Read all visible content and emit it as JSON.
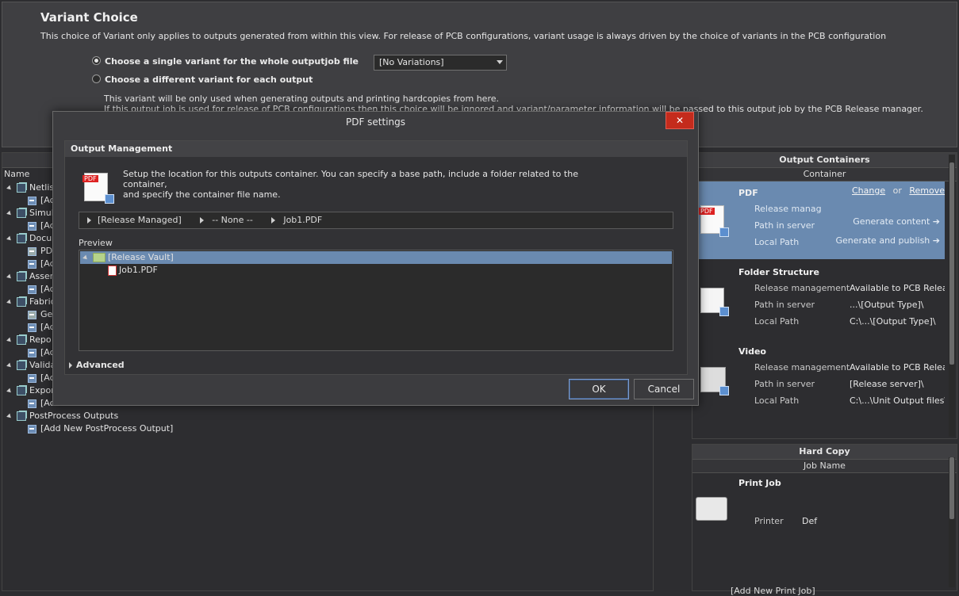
{
  "variant": {
    "title": "Variant Choice",
    "description": "This choice of Variant only applies to outputs generated from within this view. For release of PCB configurations, variant usage is always driven by the choice of variants in the PCB configuration",
    "option_single": "Choose a single variant for the whole outputjob file",
    "option_each": "Choose a different variant for each output",
    "selected_variant": "[No Variations]",
    "note_line1": "This variant will be only used when generating outputs and printing hardcopies from here.",
    "note_line2": "If this output job is used for release of PCB configurations then this choice will be ignored and variant/parameter information will be passed to this output job by the PCB Release manager."
  },
  "tree": {
    "name_header": "Name",
    "rows": [
      {
        "label": "Netlis",
        "kind": "category"
      },
      {
        "label": "[Ac",
        "kind": "add"
      },
      {
        "label": "Simul",
        "kind": "category"
      },
      {
        "label": "[Ac",
        "kind": "add"
      },
      {
        "label": "Docu",
        "kind": "category"
      },
      {
        "label": "PD",
        "kind": "item"
      },
      {
        "label": "[Ac",
        "kind": "add"
      },
      {
        "label": "Assem",
        "kind": "category"
      },
      {
        "label": "[Ac",
        "kind": "add"
      },
      {
        "label": "Fabric",
        "kind": "category"
      },
      {
        "label": "Ge",
        "kind": "item"
      },
      {
        "label": "[Ac",
        "kind": "add"
      },
      {
        "label": "Repo",
        "kind": "category"
      },
      {
        "label": "[Ac",
        "kind": "add"
      },
      {
        "label": "Valida",
        "kind": "category"
      },
      {
        "label": "[Ac",
        "kind": "add"
      },
      {
        "label": "Expor",
        "kind": "category"
      },
      {
        "label": "[Ac",
        "kind": "add"
      },
      {
        "label": "PostProcess Outputs",
        "kind": "category"
      },
      {
        "label": "[Add New PostProcess Output]",
        "kind": "add"
      }
    ]
  },
  "containers": {
    "header": "Output Containers",
    "subheader": "Container",
    "pdf": {
      "title": "PDF",
      "change": "Change",
      "or": "or",
      "remove": "Remove",
      "row1": "Release manag",
      "row2": "Path in server",
      "row3": "Local Path",
      "generate_content": "Generate content",
      "generate_publish": "Generate and publish"
    },
    "folder": {
      "title": "Folder Structure",
      "row1": "Release management",
      "val1": "Available to PCB Releas",
      "row2": "Path in server",
      "val2": "...\\[Output Type]\\",
      "row3": "Local Path",
      "val3": "C:\\...\\[Output Type]\\"
    },
    "video": {
      "title": "Video",
      "row1": "Release management",
      "val1": "Available to PCB Releas",
      "row2": "Path in server",
      "val2": "[Release server]\\",
      "row3": "Local Path",
      "val3": "C:\\...\\Unit Output files\\"
    }
  },
  "hardcopy": {
    "header": "Hard Copy",
    "subheader": "Job Name",
    "job_title": "Print Job",
    "printer_label": "Printer",
    "printer_value": "Def",
    "add_new": "[Add New Print Job]"
  },
  "dialog": {
    "title": "PDF settings",
    "close": "✕",
    "section_title": "Output Management",
    "desc_line1": "Setup the location for this outputs container. You can specify a base path, include a folder related to the container,",
    "desc_line2": "and specify the container file name.",
    "path1": "[Release Managed]",
    "path2": "-- None --",
    "path3": "Job1.PDF",
    "preview_label": "Preview",
    "vault_label": "[Release Vault]",
    "file_label": "Job1.PDF",
    "advanced": "Advanced",
    "ok": "OK",
    "cancel": "Cancel"
  },
  "colors": {
    "selection": "#6a8ab0",
    "close": "#c42b1c",
    "background": "#2d2d30"
  }
}
